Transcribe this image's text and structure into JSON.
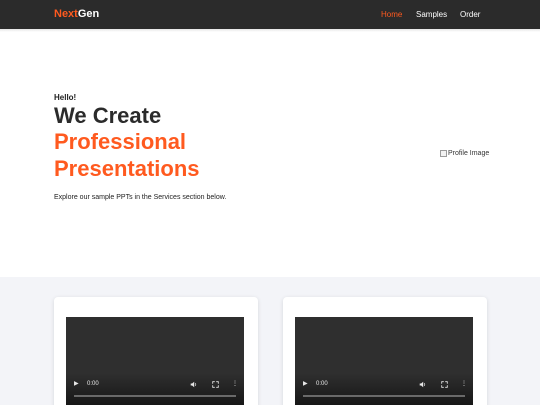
{
  "nav": {
    "brand_part1": "Next",
    "brand_part2": "Gen",
    "links": [
      {
        "label": "Home",
        "active": true
      },
      {
        "label": "Samples",
        "active": false
      },
      {
        "label": "Order",
        "active": false
      }
    ],
    "bg_color": "#2b2b2b",
    "accent_color": "#ff5a1f"
  },
  "hero": {
    "greeting": "Hello!",
    "line1": "We Create",
    "line2": "Professional",
    "line3": "Presentations",
    "subtitle": "Explore our sample PPTs in the Services section below.",
    "profile_alt": "Profile Image"
  },
  "services": {
    "videos": [
      {
        "time": "0:00",
        "play_icon": "play-icon",
        "volume_icon": "volume-icon",
        "fullscreen_icon": "fullscreen-icon",
        "more_icon": "more-options-icon"
      },
      {
        "time": "0:00",
        "play_icon": "play-icon",
        "volume_icon": "volume-icon",
        "fullscreen_icon": "fullscreen-icon",
        "more_icon": "more-options-icon"
      }
    ],
    "bg_color": "#f3f4f8"
  }
}
